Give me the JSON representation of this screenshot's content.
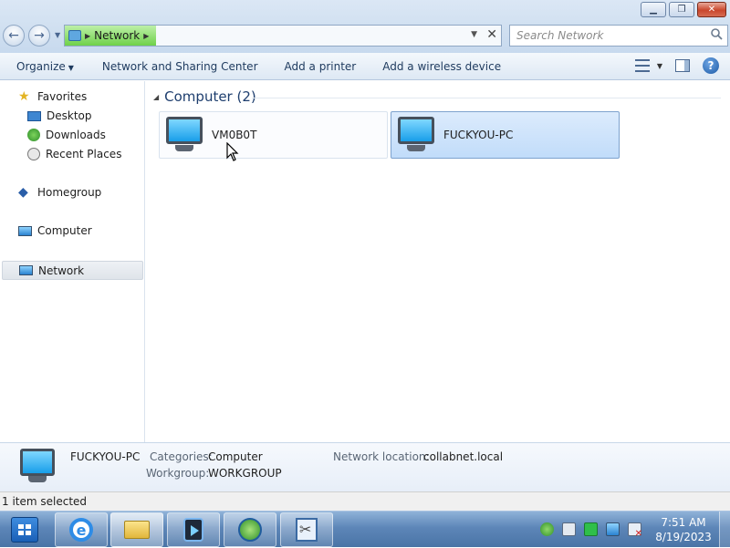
{
  "toolbar": {
    "breadcrumb": "Network",
    "search_placeholder": "Search Network"
  },
  "commands": {
    "organize": "Organize",
    "network_sharing": "Network and Sharing Center",
    "add_printer": "Add a printer",
    "add_wireless": "Add a wireless device"
  },
  "sidebar": {
    "favorites": "Favorites",
    "desktop": "Desktop",
    "downloads": "Downloads",
    "recent_places": "Recent Places",
    "homegroup": "Homegroup",
    "computer": "Computer",
    "network": "Network"
  },
  "main": {
    "group_header": "Computer (2)",
    "items": [
      {
        "name": "VM0B0T",
        "selected": false
      },
      {
        "name": "FUCKYOU-PC",
        "selected": true
      }
    ]
  },
  "details": {
    "name": "FUCKYOU-PC",
    "categories_label": "Categories:",
    "categories_value": "Computer",
    "workgroup_label": "Workgroup:",
    "workgroup_value": "WORKGROUP",
    "network_location_label": "Network location:",
    "network_location_value": "collabnet.local"
  },
  "status": {
    "selection": "1 item selected"
  },
  "taskbar": {
    "time": "7:51 AM",
    "date": "8/19/2023"
  },
  "colors": {
    "accent": "#1e3e6e",
    "selection": "#c1dcfa",
    "taskbar": "#5d86b8"
  }
}
